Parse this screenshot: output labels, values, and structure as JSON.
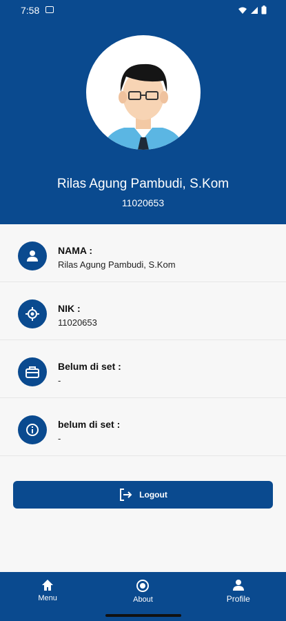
{
  "status_bar": {
    "time": "7:58"
  },
  "profile": {
    "name": "Rilas Agung Pambudi, S.Kom",
    "nik": "11020653"
  },
  "info_rows": [
    {
      "title": "NAMA :",
      "value": "Rilas Agung Pambudi, S.Kom",
      "icon": "person-icon"
    },
    {
      "title": "NIK :",
      "value": "11020653",
      "icon": "target-icon"
    },
    {
      "title": "Belum di set :",
      "value": "-",
      "icon": "briefcase-icon"
    },
    {
      "title": "belum di set :",
      "value": "-",
      "icon": "info-icon"
    }
  ],
  "logout": {
    "label": "Logout",
    "icon": "logout-icon"
  },
  "bottom_nav": [
    {
      "label": "Menu",
      "icon": "home-icon"
    },
    {
      "label": "About",
      "icon": "radio-icon"
    },
    {
      "label": "Profile",
      "icon": "person-icon"
    }
  ],
  "colors": {
    "primary": "#0a4a8f",
    "background": "#f7f7f7"
  }
}
